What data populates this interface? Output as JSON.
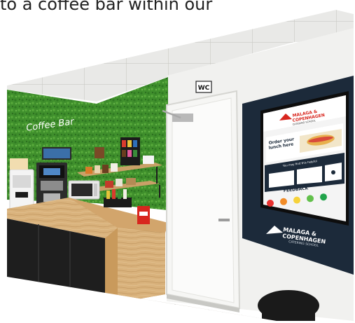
{
  "caption": "to a coffee bar within our",
  "wall_sign": {
    "text": "Coffee Bar"
  },
  "door_sign": {
    "text": "WC"
  },
  "kiosk": {
    "brand_line1": "MALAGA &",
    "brand_line2": "COPENHAGEN",
    "brand_sub": "CATERING SCHOOL",
    "order_text_line1": "Order your",
    "order_text_line2": "lunch here",
    "helpful_text": "You may find this helpful",
    "feedback_title": "FEEDBACK",
    "feedback_colors": [
      "#e8312f",
      "#f28c28",
      "#f6d23a",
      "#62c04b",
      "#21a34a"
    ],
    "bezel_line1": "MALAGA &",
    "bezel_line2": "COPENHAGEN",
    "bezel_sub": "CATERING SCHOOL"
  },
  "colors": {
    "green_wall": "#3f8f2c",
    "countertop": "#d9b27c",
    "cabinet": "#1e1e1e",
    "kiosk_frame": "#1c2a3a"
  }
}
